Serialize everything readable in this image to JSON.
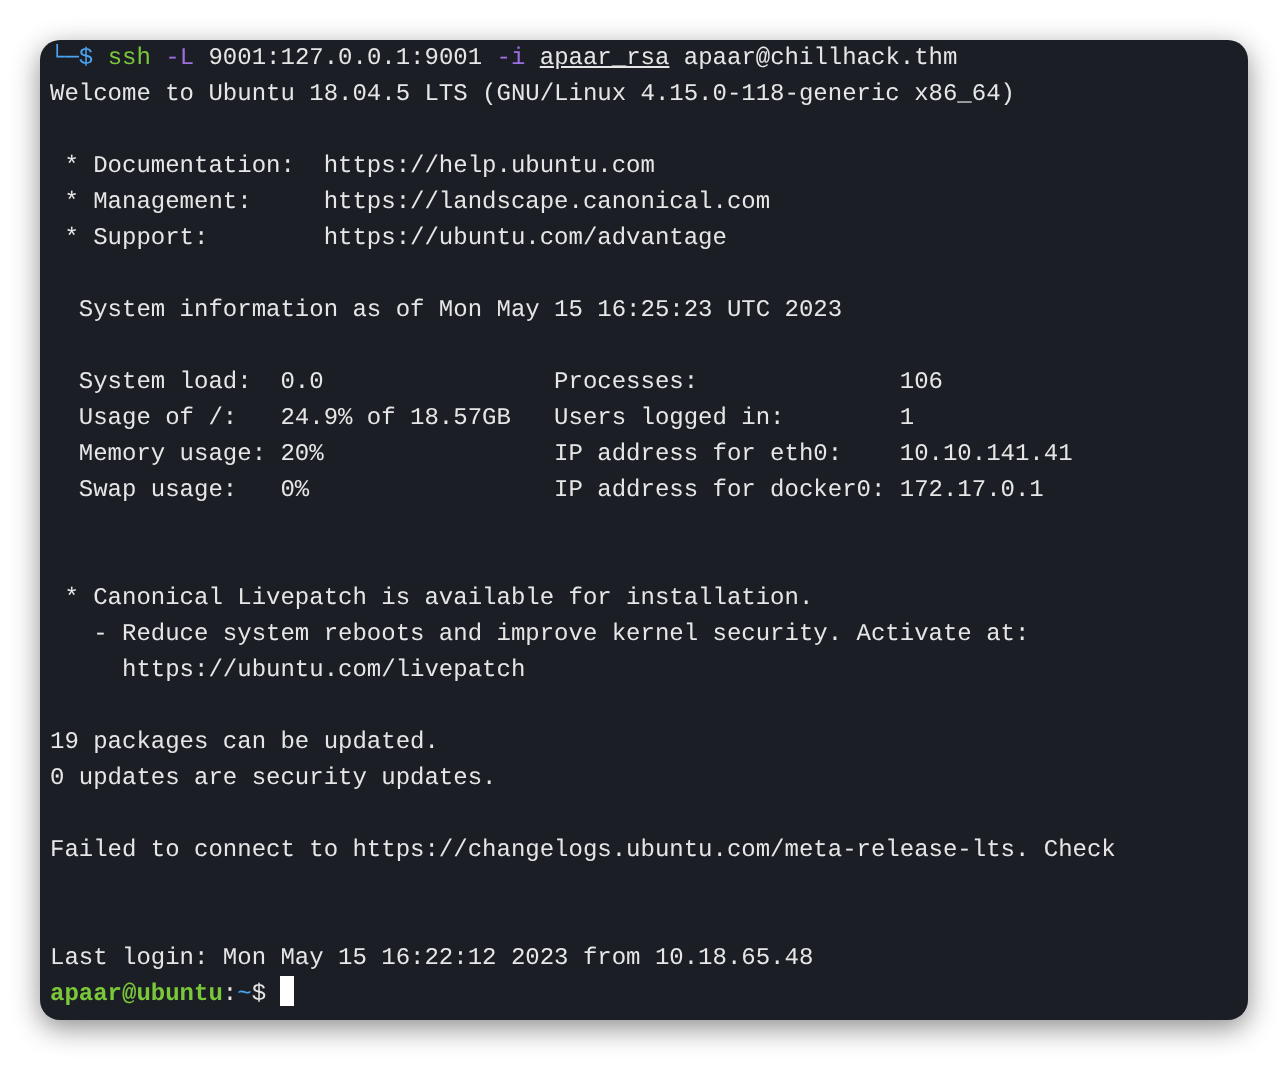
{
  "terminal": {
    "lines": [
      {
        "kind": "segments",
        "segments": [
          {
            "kind": "prompt",
            "text": "└─$ "
          },
          {
            "kind": "command",
            "text": "ssh "
          },
          {
            "kind": "flag",
            "text": "-L "
          },
          {
            "kind": "plain",
            "text": "9001:127.0.0.1:9001 "
          },
          {
            "kind": "flag",
            "text": "-i "
          },
          {
            "kind": "path",
            "text": "apaar_rsa"
          },
          {
            "kind": "plain",
            "text": " apaar@chillhack.thm"
          }
        ]
      },
      {
        "kind": "text",
        "text": "Welcome to Ubuntu 18.04.5 LTS (GNU/Linux 4.15.0-118-generic x86_64)"
      },
      {
        "kind": "blank"
      },
      {
        "kind": "text",
        "text": " * Documentation:  https://help.ubuntu.com"
      },
      {
        "kind": "text",
        "text": " * Management:     https://landscape.canonical.com"
      },
      {
        "kind": "text",
        "text": " * Support:        https://ubuntu.com/advantage"
      },
      {
        "kind": "blank"
      },
      {
        "kind": "text",
        "text": "  System information as of Mon May 15 16:25:23 UTC 2023"
      },
      {
        "kind": "blank"
      },
      {
        "kind": "text",
        "text": "  System load:  0.0                Processes:              106"
      },
      {
        "kind": "text",
        "text": "  Usage of /:   24.9% of 18.57GB   Users logged in:        1"
      },
      {
        "kind": "text",
        "text": "  Memory usage: 20%                IP address for eth0:    10.10.141.41"
      },
      {
        "kind": "text",
        "text": "  Swap usage:   0%                 IP address for docker0: 172.17.0.1"
      },
      {
        "kind": "blank"
      },
      {
        "kind": "blank"
      },
      {
        "kind": "text",
        "text": " * Canonical Livepatch is available for installation."
      },
      {
        "kind": "text",
        "text": "   - Reduce system reboots and improve kernel security. Activate at:"
      },
      {
        "kind": "text",
        "text": "     https://ubuntu.com/livepatch"
      },
      {
        "kind": "blank"
      },
      {
        "kind": "text",
        "text": "19 packages can be updated."
      },
      {
        "kind": "text",
        "text": "0 updates are security updates."
      },
      {
        "kind": "blank"
      },
      {
        "kind": "text",
        "text": "Failed to connect to https://changelogs.ubuntu.com/meta-release-lts. Check"
      },
      {
        "kind": "blank"
      },
      {
        "kind": "blank"
      },
      {
        "kind": "text",
        "text": "Last login: Mon May 15 16:22:12 2023 from 10.18.65.48"
      },
      {
        "kind": "segments",
        "cursor": true,
        "segments": [
          {
            "kind": "user",
            "text": "apaar@ubuntu"
          },
          {
            "kind": "plain",
            "text": ":"
          },
          {
            "kind": "dir",
            "text": "~"
          },
          {
            "kind": "plain",
            "text": "$ "
          }
        ]
      }
    ]
  }
}
